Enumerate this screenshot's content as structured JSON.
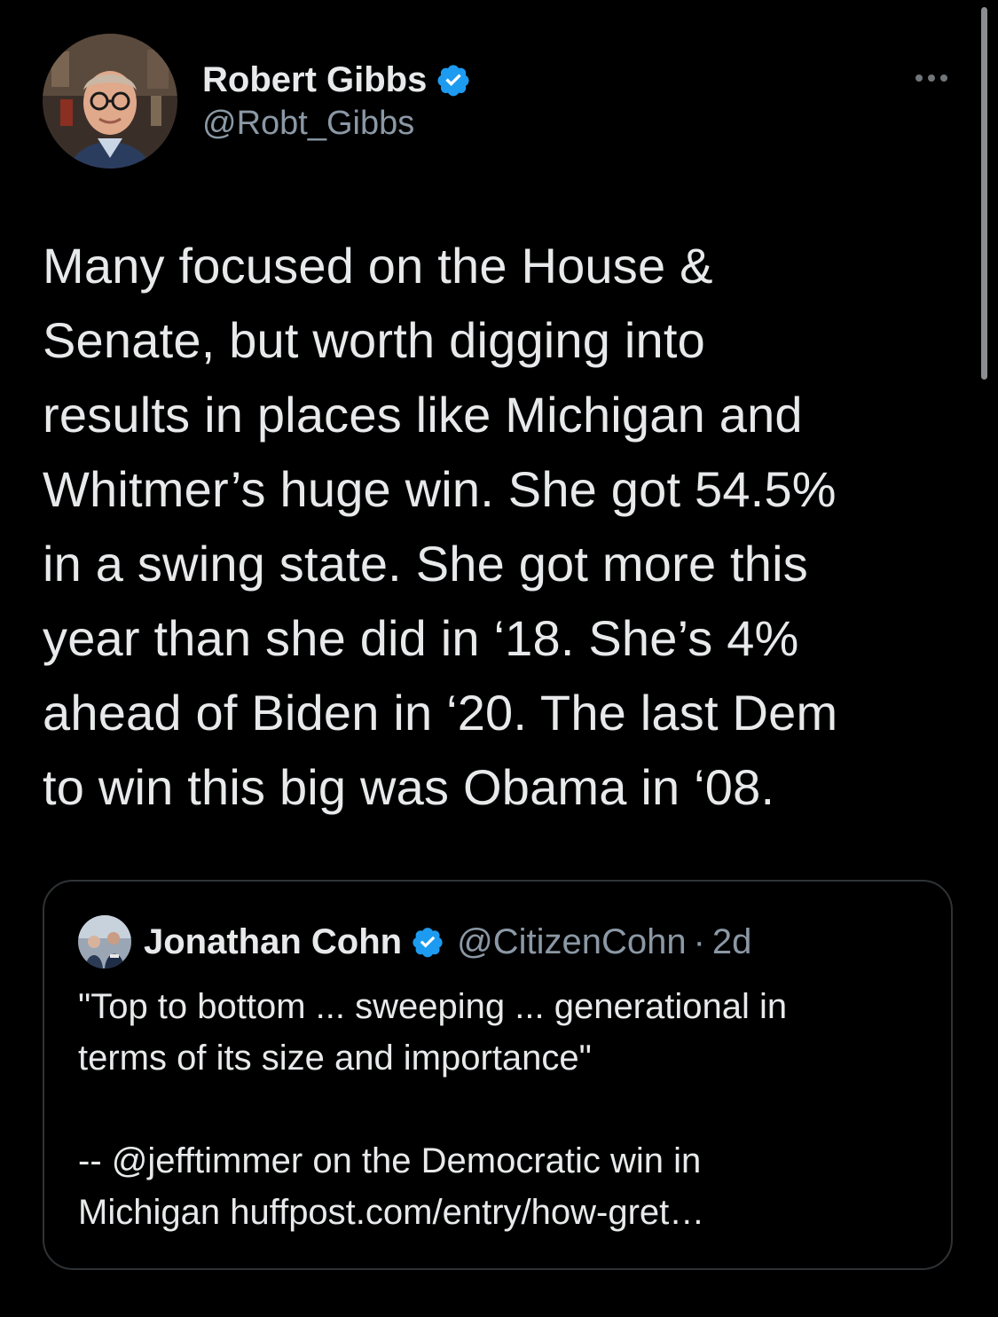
{
  "tweet": {
    "author": {
      "display_name": "Robert Gibbs",
      "handle": "@Robt_Gibbs",
      "verified": true,
      "avatar_icon": "profile-photo"
    },
    "more_icon": "more-horizontal-icon",
    "text_lines": [
      "Many focused on the House &",
      "Senate, but worth digging into",
      "results in places like Michigan and",
      "Whitmer’s huge win. She got 54.5%",
      "in a swing state. She got more this",
      "year than she did in ‘18. She’s 4%",
      "ahead of Biden in ‘20. The last Dem",
      "to win this big was Obama in ‘08."
    ]
  },
  "quote": {
    "author": {
      "display_name": "Jonathan Cohn",
      "handle": "@CitizenCohn",
      "separator": "·",
      "time": "2d",
      "verified": true,
      "avatar_icon": "profile-photo"
    },
    "text_lines_1": [
      "\"Top to bottom ...  sweeping ... generational in",
      "terms of its size and importance\""
    ],
    "text_lines_2": [
      "-- @jefftimmer on the Democratic win in",
      "Michigan huffpost.com/entry/how-gret…"
    ]
  },
  "colors": {
    "background": "#000000",
    "text_primary": "#e7e9ea",
    "text_secondary": "#8b98a5",
    "verified_blue": "#1d9bf0",
    "card_border": "#2f3336"
  }
}
